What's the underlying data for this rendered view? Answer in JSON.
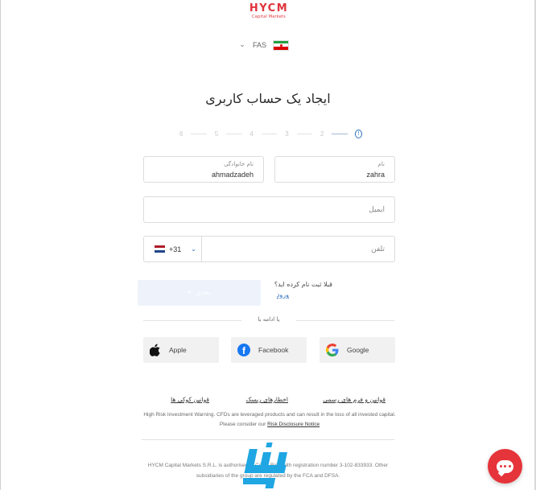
{
  "brand": {
    "logo_text": "HYCM",
    "logo_subtitle": "Capital Markets"
  },
  "language": {
    "code": "FAS",
    "flag": "iran-flag-icon"
  },
  "page_title": "ایجاد یک حساب کاربری",
  "stepper": {
    "current_icon": "!",
    "steps": [
      "2",
      "3",
      "4",
      "5",
      "6"
    ]
  },
  "form": {
    "first_name": {
      "label": "نام",
      "value": "zahra"
    },
    "last_name": {
      "label": "نام خانوادگی",
      "value": "ahmadzadeh"
    },
    "email": {
      "placeholder": "ایمیل"
    },
    "phone": {
      "country_code": "+31",
      "placeholder": "تلفن"
    },
    "next_button": "بعدی ←"
  },
  "login": {
    "prompt": "قبلا ثبت نام کرده اید؟",
    "link": "ورود"
  },
  "social": {
    "divider_text": "یا ادامه با",
    "apple": "Apple",
    "facebook": "Facebook",
    "google": "Google"
  },
  "footer": {
    "link_terms": "قوانین و فرم های رسمی",
    "link_risk": "اخطارهای ریسک",
    "link_cookies": "قوانین کوکی ها",
    "warning_text": "High Risk Investment Warning. CFDs are leveraged products and can result in the loss of all invested capital. Please consider our",
    "warning_link": "Risk Disclosure Notice",
    "legal_text": "HYCM Capital Markets S.R.L. is authorised in Costa Rica with registration number 3-102-833933. Other subsidiaries of the group are regulated by the FCA and DFSA."
  },
  "colors": {
    "accent": "#e0343c",
    "link": "#2f6fbf",
    "chat": "#e5343a",
    "watermark": "#1fa6e3"
  }
}
